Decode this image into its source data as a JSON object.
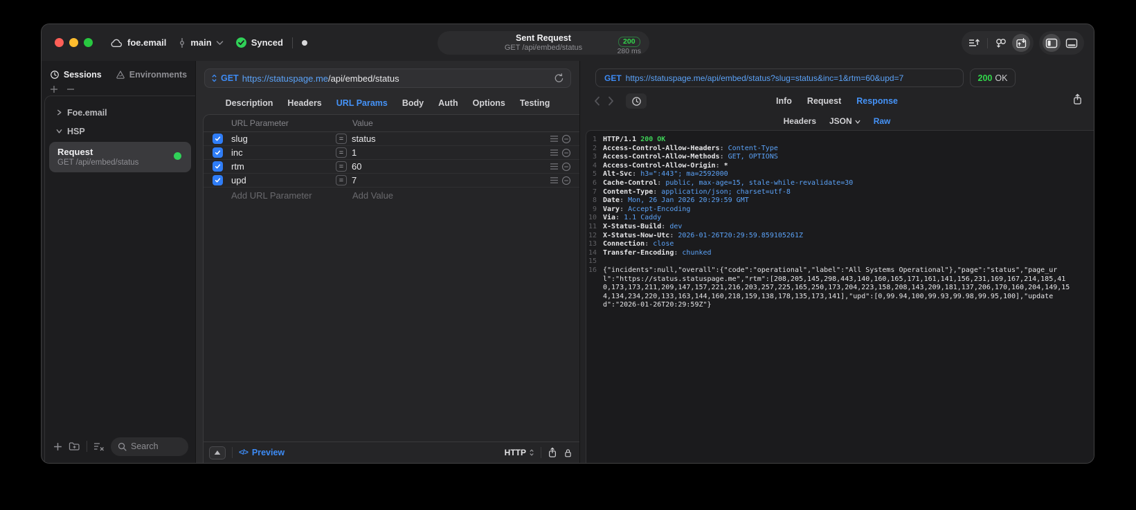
{
  "titlebar": {
    "project": "foe.email",
    "branch": "main",
    "sync_label": "Synced",
    "center": {
      "title": "Sent Request",
      "subtitle": "GET /api/embed/status",
      "status_code": "200",
      "duration": "280 ms"
    }
  },
  "sidebar": {
    "tabs": [
      {
        "label": "Sessions",
        "icon": "clock",
        "active": true
      },
      {
        "label": "Environments",
        "icon": "environments",
        "active": false
      }
    ],
    "tree": [
      {
        "label": "Foe.email",
        "expanded": false
      },
      {
        "label": "HSP",
        "expanded": true
      }
    ],
    "request": {
      "title": "Request",
      "subtitle": "GET /api/embed/status"
    },
    "search_placeholder": "Search"
  },
  "request_panel": {
    "method": "GET",
    "url_host": "https://statuspage.me",
    "url_path": "/api/embed/status",
    "tabs": [
      "Description",
      "Headers",
      "URL Params",
      "Body",
      "Auth",
      "Options",
      "Testing"
    ],
    "active_tab": "URL Params",
    "table": {
      "columns": [
        "URL Parameter",
        "Value"
      ],
      "operator": "=",
      "rows": [
        {
          "name": "slug",
          "value": "status",
          "enabled": true
        },
        {
          "name": "inc",
          "value": "1",
          "enabled": true
        },
        {
          "name": "rtm",
          "value": "60",
          "enabled": true
        },
        {
          "name": "upd",
          "value": "7",
          "enabled": true
        }
      ],
      "add_param_placeholder": "Add URL Parameter",
      "add_value_placeholder": "Add Value"
    },
    "footer": {
      "preview_icon": "</>",
      "preview_label": "Preview",
      "protocol": "HTTP"
    }
  },
  "response_panel": {
    "method": "GET",
    "url": "https://statuspage.me/api/embed/status?slug=status&inc=1&rtm=60&upd=7",
    "status_code": "200",
    "status_text": "OK",
    "tabs": [
      "Info",
      "Request",
      "Response"
    ],
    "active_tab": "Response",
    "subtabs": [
      "Headers",
      "JSON",
      "Raw"
    ],
    "active_subtab": "Raw",
    "dropdown_subtab": "JSON",
    "code": {
      "status_line": {
        "plain": "HTTP/1.1 ",
        "highlight": "200 OK"
      },
      "headers": [
        {
          "name": "Access-Control-Allow-Headers",
          "value": "Content-Type"
        },
        {
          "name": "Access-Control-Allow-Methods",
          "value": "GET, OPTIONS"
        },
        {
          "name": "Access-Control-Allow-Origin",
          "value": "*",
          "plain": true
        },
        {
          "name": "Alt-Svc",
          "value": "h3=\":443\"; ma=2592000"
        },
        {
          "name": "Cache-Control",
          "value": "public, max-age=15, stale-while-revalidate=30"
        },
        {
          "name": "Content-Type",
          "value": "application/json; charset=utf-8"
        },
        {
          "name": "Date",
          "value": "Mon, 26 Jan 2026 20:29:59 GMT"
        },
        {
          "name": "Vary",
          "value": "Accept-Encoding"
        },
        {
          "name": "Via",
          "value": "1.1 Caddy"
        },
        {
          "name": "X-Status-Build",
          "value": "dev"
        },
        {
          "name": "X-Status-Now-Utc",
          "value": "2026-01-26T20:29:59.859105261Z"
        },
        {
          "name": "Connection",
          "value": "close"
        },
        {
          "name": "Transfer-Encoding",
          "value": "chunked"
        }
      ],
      "body": "{\"incidents\":null,\"overall\":{\"code\":\"operational\",\"label\":\"All Systems Operational\"},\"page\":\"status\",\"page_url\":\"https://status.statuspage.me\",\"rtm\":[208,205,145,298,443,140,160,165,171,161,141,156,231,169,167,214,185,410,173,173,211,209,147,157,221,216,203,257,225,165,250,173,204,223,158,208,143,209,181,137,206,170,160,204,149,154,134,234,220,133,163,144,160,218,159,138,178,135,173,141],\"upd\":[0,99.94,100,99.93,99.98,99.95,100],\"updated\":\"2026-01-26T20:29:59Z\"}"
    },
    "colors": {
      "accent_blue": "#4593f8",
      "success_green": "#32d74b",
      "value_blue": "#5ba2f7"
    }
  }
}
